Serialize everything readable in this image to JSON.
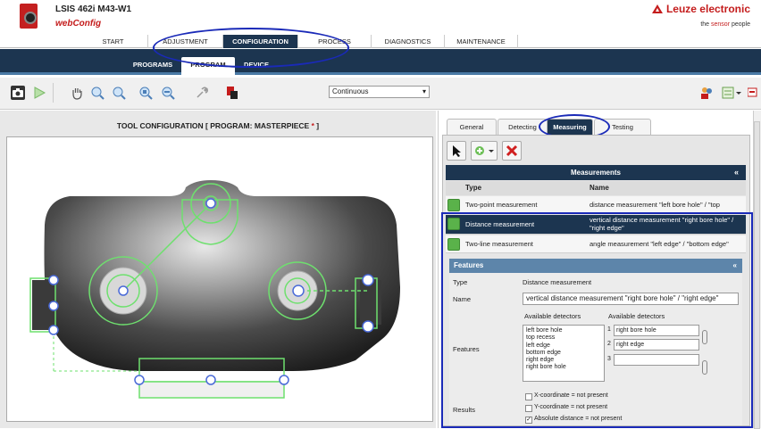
{
  "header": {
    "product": "LSIS 462i M43-W1",
    "app_name_web": "web",
    "app_name_config": "Config",
    "brand": "Leuze electronic",
    "tagline_prefix": "the ",
    "tagline_highlight": "sensor",
    "tagline_suffix": " people"
  },
  "main_nav": [
    "START",
    "ADJUSTMENT",
    "CONFIGURATION",
    "PROCESS",
    "DIAGNOSTICS",
    "MAINTENANCE"
  ],
  "main_nav_active": "CONFIGURATION",
  "sub_nav": [
    "PROGRAMS",
    "PROGRAM",
    "DEVICE"
  ],
  "sub_nav_active": "PROGRAM",
  "toolbar": {
    "trigger_mode": "Continuous",
    "icons": [
      "camera-icon",
      "play-icon",
      "hand-icon",
      "zoom-in-icon",
      "zoom-out-icon",
      "zoom-fit-icon",
      "zoom-reset-icon",
      "wrench-icon",
      "program-transfer-icon"
    ],
    "right_icons": [
      "users-icon",
      "layout-icon",
      "flag-icon"
    ]
  },
  "tool_config": {
    "title": "TOOL CONFIGURATION   [ PROGRAM: MASTERPIECE",
    "modified_mark": "*",
    "title_end": " ]"
  },
  "right_tabs": [
    "General",
    "Detecting",
    "Measuring",
    "Testing"
  ],
  "right_tab_active": "Measuring",
  "measurements": {
    "title": "Measurements",
    "col_type": "Type",
    "col_name": "Name",
    "rows": [
      {
        "type": "Two-point measurement",
        "name": "distance measurement \"left bore hole\" / \"top recess\""
      },
      {
        "type": "Distance measurement",
        "name": "vertical distance measurement \"right bore hole\" / \"right edge\""
      },
      {
        "type": "Two-line measurement",
        "name": "angle measurement \"left edge\" / \"bottom edge\""
      }
    ],
    "selected_index": 1
  },
  "features": {
    "title": "Features",
    "type_label": "Type",
    "type_value": "Distance measurement",
    "name_label": "Name",
    "name_value": "vertical distance measurement \"right bore hole\" / \"right edge\"",
    "features_label": "Features",
    "available_header": "Available detectors",
    "selected_header": "Available detectors",
    "available_list": [
      "left bore hole",
      "top recess",
      "left edge",
      "bottom edge",
      "right edge",
      "right bore hole"
    ],
    "slot1": "right bore hole",
    "slot2": "right edge",
    "slot3": "",
    "results_label": "Results",
    "results": [
      {
        "label": "X-coordinate = not present",
        "checked": false
      },
      {
        "label": "Y-coordinate = not present",
        "checked": false
      },
      {
        "label": "Absolute distance = not present",
        "checked": true
      }
    ]
  },
  "colors": {
    "nav_dark": "#1c3550",
    "brand_red": "#c41c1c",
    "feature_head": "#5d85aa",
    "overlay_green": "#6ee06e",
    "overlay_blue": "#5070e0",
    "highlight": "#1a2ab8"
  }
}
